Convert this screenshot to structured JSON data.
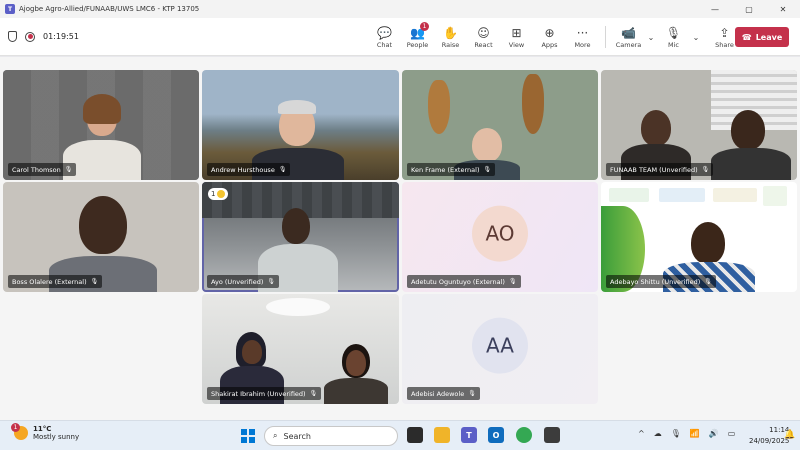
{
  "window": {
    "title": "Ajogbe Agro-Allied/FUNAAB/UWS LMC6 - KTP 13705",
    "minimize": "—",
    "maximize": "▢",
    "close": "✕"
  },
  "meeting": {
    "timer": "01:19:51"
  },
  "toolbar": {
    "chat": "Chat",
    "people": "People",
    "people_badge": "1",
    "raise": "Raise",
    "react": "React",
    "view": "View",
    "apps": "Apps",
    "more": "More",
    "camera": "Camera",
    "mic": "Mic",
    "share": "Share",
    "leave": "Leave"
  },
  "participants": [
    {
      "name": "Carol Thomson"
    },
    {
      "name": "Andrew Hursthouse"
    },
    {
      "name": "Ken Frame (External)"
    },
    {
      "name": "FUNAAB TEAM (Unverified)"
    },
    {
      "name": "Boss Olalere (External)"
    },
    {
      "name": "Ayo (Unverified)",
      "reaction_count": "1"
    },
    {
      "name": "Adetutu Oguntuyo (External)",
      "initials": "AO"
    },
    {
      "name": "Adebayo Shittu (Unverified)"
    },
    {
      "name": "Shakirat Ibrahim (Unverified)"
    },
    {
      "name": "Adebisi Adewole",
      "initials": "AA"
    }
  ],
  "taskbar": {
    "weather_temp": "11°C",
    "weather_desc": "Mostly sunny",
    "weather_badge": "1",
    "search_placeholder": "Search",
    "time": "11:14",
    "date": "24/09/2025"
  },
  "colors": {
    "accent": "#6264a7",
    "leave": "#c4314b"
  }
}
